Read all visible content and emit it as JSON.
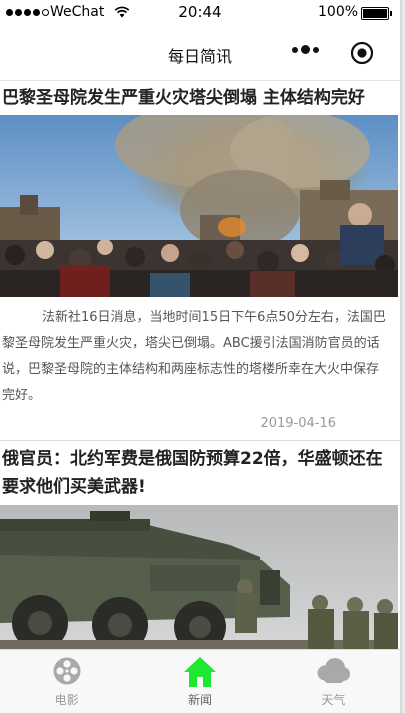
{
  "status_bar": {
    "carrier": "WeChat",
    "time": "20:44",
    "battery_percent": "100%",
    "battery_level": 1.0
  },
  "nav_bar": {
    "title": "每日简讯"
  },
  "news": [
    {
      "title": "巴黎圣母院发生严重火灾塔尖倒塌 主体结构完好",
      "summary": "法新社16日消息，当地时间15日下午6点50分左右，法国巴黎圣母院发生严重火灾，塔尖已倒塌。ABC援引法国消防官员的话说，巴黎圣母院的主体结构和两座标志性的塔楼所幸在大火中保存完好。",
      "date": "2019-04-16"
    },
    {
      "title": "俄官员：北约军费是俄国防预算22倍，华盛顿还在要求他们买美武器!"
    }
  ],
  "tab_bar": {
    "items": [
      {
        "label": "电影",
        "icon": "film-reel-icon",
        "active": false
      },
      {
        "label": "新闻",
        "icon": "home-icon",
        "active": true
      },
      {
        "label": "天气",
        "icon": "cloud-icon",
        "active": false
      }
    ],
    "active_color": "#1ee831",
    "inactive_color": "#a9a9a9"
  }
}
